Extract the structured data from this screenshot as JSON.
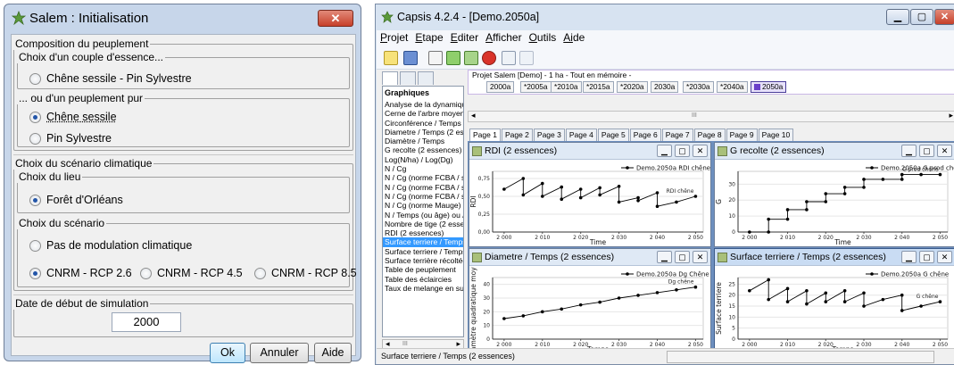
{
  "dialog": {
    "title": "Salem : Initialisation",
    "composition_legend": "Composition du peuplement",
    "couple_legend": "Choix d'un couple d'essence...",
    "couple_option": "Chêne sessile - Pin Sylvestre",
    "pur_legend": "... ou d'un peuplement pur",
    "pur_options": [
      "Chêne sessile",
      "Pin Sylvestre"
    ],
    "climate_legend": "Choix du scénario climatique",
    "lieu_legend": "Choix du lieu",
    "lieu_option": "Forêt d'Orléans",
    "scenario_legend": "Choix du scénario",
    "scenario_none": "Pas de modulation climatique",
    "scenario_options": [
      "CNRM - RCP 2.6",
      "CNRM - RCP 4.5",
      "CNRM - RCP 8.5"
    ],
    "date_legend": "Date de début de simulation",
    "date_value": "2000",
    "ok_label": "Ok",
    "cancel_label": "Annuler",
    "help_label": "Aide"
  },
  "capsis": {
    "title": "Capsis 4.2.4 - [Demo.2050a]",
    "menu": [
      {
        "u": "P",
        "rest": "rojet"
      },
      {
        "u": "E",
        "rest": "tape"
      },
      {
        "u": "E",
        "rest": "diter"
      },
      {
        "u": "A",
        "rest": "fficher"
      },
      {
        "u": "O",
        "rest": "utils"
      },
      {
        "u": "Ai",
        "rest": "de"
      }
    ],
    "left_header": "Graphiques",
    "graph_list": [
      "Analyse de la dynamique",
      "Cerne de l'arbre moyen /",
      "Circonférence / Temps",
      "Diametre / Temps (2 esse",
      "Diamètre / Temps",
      "G recolte (2 essences)",
      "Log(N/ha) / Log(Dg)",
      "N / Cg",
      "N / Cg (norme FCBA / sta",
      "N / Cg (norme FCBA / sta",
      "N / Cg (norme FCBA / sta",
      "N / Cg (norme Mauge)",
      "N / Temps (ou âge) ou /",
      "Nombre de tige (2 essenc",
      "RDI (2 essences)",
      "Surface terriere / Temps",
      "Surface terriere / Temps",
      "Surface terrière récoltée",
      "Table de peuplement",
      "Table des éclaircies",
      "Taux de melange en surfa"
    ],
    "selected_graph": "Surface terriere / Temps",
    "project_label": "Projet Salem [Demo] - 1 ha - Tout en mémoire -",
    "steps": [
      "2000a",
      "*2005a",
      "*2010a",
      "*2015a",
      "*2020a",
      "2030a",
      "*2030a",
      "*2040a",
      "2050a"
    ],
    "current_step": "2050a",
    "pages": [
      "Page 1",
      "Page 2",
      "Page 3",
      "Page 4",
      "Page 5",
      "Page 6",
      "Page 7",
      "Page 8",
      "Page 9",
      "Page 10"
    ],
    "status_text": "Surface terriere / Temps (2 essences)",
    "scroll_mark": "III"
  },
  "chart_data": [
    {
      "type": "line",
      "window_title": "RDI (2 essences)",
      "legend": "Demo.2050a RDI chêne",
      "series_label": "RDI chêne",
      "xlabel": "Time",
      "ylabel": "RDI",
      "xticks": [
        "2 000",
        "2 010",
        "2 020",
        "2 030",
        "2 040",
        "2 050"
      ],
      "yticks": [
        "0,00",
        "0,25",
        "0,50",
        "0,75"
      ],
      "xlim": [
        1997,
        2052
      ],
      "ylim": [
        0,
        0.85
      ],
      "x": [
        2000,
        2005,
        2005,
        2010,
        2010,
        2015,
        2015,
        2020,
        2020,
        2025,
        2025,
        2030,
        2030,
        2035,
        2035,
        2040,
        2040,
        2045,
        2050
      ],
      "y": [
        0.6,
        0.75,
        0.52,
        0.68,
        0.5,
        0.63,
        0.46,
        0.6,
        0.48,
        0.62,
        0.52,
        0.64,
        0.42,
        0.48,
        0.44,
        0.55,
        0.36,
        0.42,
        0.5
      ]
    },
    {
      "type": "line",
      "window_title": "G recolte (2 essences)",
      "legend": "Demo.2050a G prod chêne",
      "series_label": "G prod chêne",
      "xlabel": "Time",
      "ylabel": "G",
      "xticks": [
        "2 000",
        "2 010",
        "2 020",
        "2 030",
        "2 040",
        "2 050"
      ],
      "yticks": [
        "0",
        "10",
        "20",
        "30"
      ],
      "xlim": [
        1997,
        2052
      ],
      "ylim": [
        0,
        38
      ],
      "x": [
        2000,
        2005,
        2005,
        2010,
        2010,
        2015,
        2015,
        2020,
        2020,
        2025,
        2025,
        2030,
        2030,
        2035,
        2040,
        2040,
        2045,
        2050
      ],
      "y": [
        0,
        0,
        8,
        8,
        14,
        14,
        19,
        19,
        24,
        24,
        28,
        28,
        33,
        33,
        33,
        36,
        36,
        36
      ]
    },
    {
      "type": "line",
      "window_title": "Diametre / Temps (2 essences)",
      "legend": "Demo.2050a Dg Chêne",
      "series_label": "Dg chêne",
      "xlabel": "Temps",
      "ylabel": "Diamètre quadratique moyen",
      "xticks": [
        "2 000",
        "2 010",
        "2 020",
        "2 030",
        "2 040",
        "2 050"
      ],
      "yticks": [
        "0",
        "10",
        "20",
        "30",
        "40"
      ],
      "xlim": [
        1997,
        2052
      ],
      "ylim": [
        0,
        45
      ],
      "x": [
        2000,
        2005,
        2010,
        2015,
        2020,
        2025,
        2030,
        2035,
        2040,
        2045,
        2050
      ],
      "y": [
        15,
        17,
        20,
        22,
        25,
        27,
        30,
        32,
        34,
        36,
        38
      ]
    },
    {
      "type": "line",
      "window_title": "Surface terriere / Temps (2 essences)",
      "legend": "Demo.2050a G chêne",
      "series_label": "G chêne",
      "xlabel": "Temps",
      "ylabel": "Surface terriere",
      "xticks": [
        "2 000",
        "2 010",
        "2 020",
        "2 030",
        "2 040",
        "2 050"
      ],
      "yticks": [
        "0",
        "5",
        "10",
        "15",
        "20",
        "25"
      ],
      "xlim": [
        1997,
        2052
      ],
      "ylim": [
        0,
        28
      ],
      "x": [
        2000,
        2005,
        2005,
        2010,
        2010,
        2015,
        2015,
        2020,
        2020,
        2025,
        2025,
        2030,
        2030,
        2035,
        2040,
        2040,
        2045,
        2050
      ],
      "y": [
        22,
        27,
        18,
        23,
        17,
        22,
        16,
        21,
        17,
        22,
        17,
        21,
        15,
        18,
        20,
        13,
        15,
        17
      ]
    }
  ]
}
